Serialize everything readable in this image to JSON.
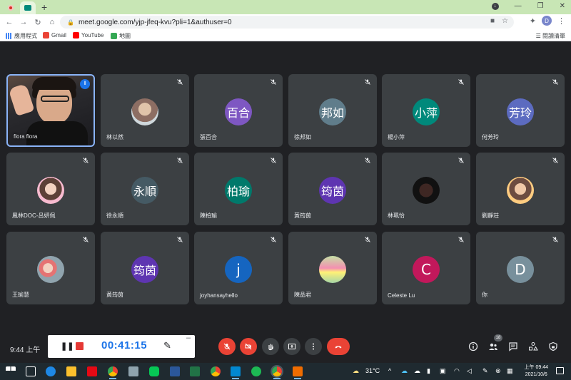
{
  "browser": {
    "url": "meet.google.com/yjp-jfeq-kvu?pli=1&authuser=0",
    "profile_initial": "D",
    "bookmarks": [
      {
        "label": "應用程式",
        "icon": "apps-icon"
      },
      {
        "label": "Gmail",
        "icon": "gmail-icon"
      },
      {
        "label": "YouTube",
        "icon": "youtube-icon"
      },
      {
        "label": "地圖",
        "icon": "maps-icon"
      }
    ],
    "reading_list": "閱讀清單"
  },
  "participants": [
    {
      "name": "flora flora",
      "type": "video-self"
    },
    {
      "name": "林以然",
      "type": "photo",
      "photo": "photo"
    },
    {
      "name": "張百合",
      "type": "initials",
      "initials": "百合",
      "color": "#7e57c2"
    },
    {
      "name": "徐邦如",
      "type": "initials",
      "initials": "邦如",
      "color": "#607d8b"
    },
    {
      "name": "楊小萍",
      "type": "initials",
      "initials": "小萍",
      "color": "#00897b"
    },
    {
      "name": "何芳玲",
      "type": "initials",
      "initials": "芳玲",
      "color": "#5c6bc0"
    },
    {
      "name": "鳳林DOC-呂妍佩",
      "type": "photo",
      "photo": "photo2"
    },
    {
      "name": "徐永順",
      "type": "initials",
      "initials": "永順",
      "color": "#455a64"
    },
    {
      "name": "陳柏瑜",
      "type": "initials",
      "initials": "柏瑜",
      "color": "#00796b"
    },
    {
      "name": "黃筠茵",
      "type": "initials",
      "initials": "筠茵",
      "color": "#5e35b1"
    },
    {
      "name": "林珮怡",
      "type": "photo",
      "photo": "photo3"
    },
    {
      "name": "劉靜荘",
      "type": "photo",
      "photo": "photo4"
    },
    {
      "name": "王瑜慧",
      "type": "photo",
      "photo": "photo5"
    },
    {
      "name": "黃筠茵",
      "type": "initials",
      "initials": "筠茵",
      "color": "#5e35b1"
    },
    {
      "name": "joyhansayhello",
      "type": "initials",
      "initials": "j",
      "color": "#1565c0"
    },
    {
      "name": "陳品君",
      "type": "photo",
      "photo": "photo6"
    },
    {
      "name": "Celeste Lu",
      "type": "initials",
      "initials": "C",
      "color": "#c2185b"
    },
    {
      "name": "你",
      "type": "initials",
      "initials": "D",
      "color": "#78909c"
    }
  ],
  "controls": {
    "time": "9:44 上午",
    "recording_timer": "00:41:15",
    "participant_count": "18"
  },
  "taskbar": {
    "weather": "31°C",
    "clock_time": "上午 09:44",
    "clock_date": "2021/10/6"
  }
}
